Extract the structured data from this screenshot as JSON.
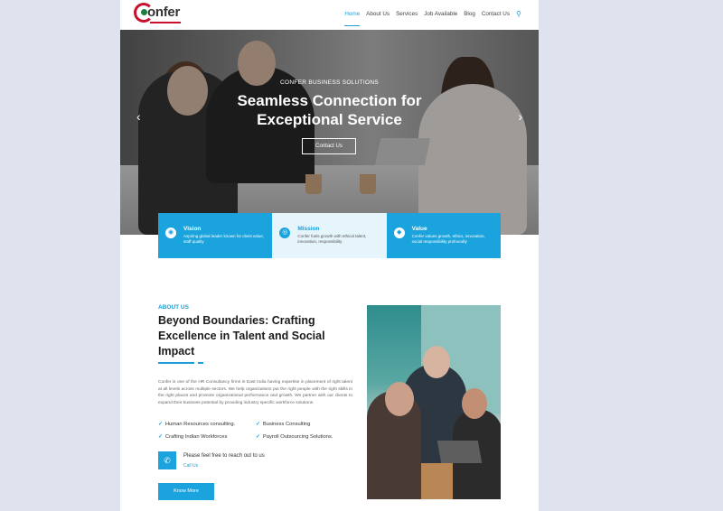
{
  "header": {
    "logo_text": "onfer",
    "nav": [
      "Home",
      "About Us",
      "Services",
      "Job Available",
      "Blog",
      "Contact Us"
    ],
    "active": "Home",
    "search_icon": "search-icon"
  },
  "hero": {
    "subtitle": "CONFER BUSINESS SOLUTIONS",
    "title_line1": "Seamless Connection for",
    "title_line2": "Exceptional Service",
    "button": "Contact Us",
    "prev_arrow": "‹",
    "next_arrow": "›"
  },
  "cards": [
    {
      "title": "Vision",
      "text": "Aspiring global leader known for client value, staff quality",
      "icon": "eye-icon"
    },
    {
      "title": "Mission",
      "text": "Confer fuels growth with ethical talent, innovation, responsibility",
      "icon": "target-icon"
    },
    {
      "title": "Value",
      "text": "Confer values growth, ethics, innovation, social responsibility profoundly",
      "icon": "diamond-icon"
    }
  ],
  "about": {
    "tag": "ABOUT US",
    "title": "Beyond Boundaries: Crafting Excellence in Talent and Social Impact",
    "body": "Confer is one of the HR Consultancy firms in East India having expertise in placement of right talent at all levels across multiple sectors. We help organizations put the right people with the right skills in the right places and promote organizational performance and growth. We partner with our clients to expand their business potential by providing industry specific workforce solutions.",
    "checks": [
      "Human Resources consulting.",
      "Business Consulting",
      "Crafting Indian Workforces",
      "Payroll Outsourcing Solutions."
    ],
    "contact_text": "Please feel free to reach out to us",
    "contact_link": "Call Us",
    "button": "Know More"
  },
  "colors": {
    "accent": "#1aa3dd",
    "logo_red": "#c8102e",
    "logo_green": "#1a7f3c"
  }
}
